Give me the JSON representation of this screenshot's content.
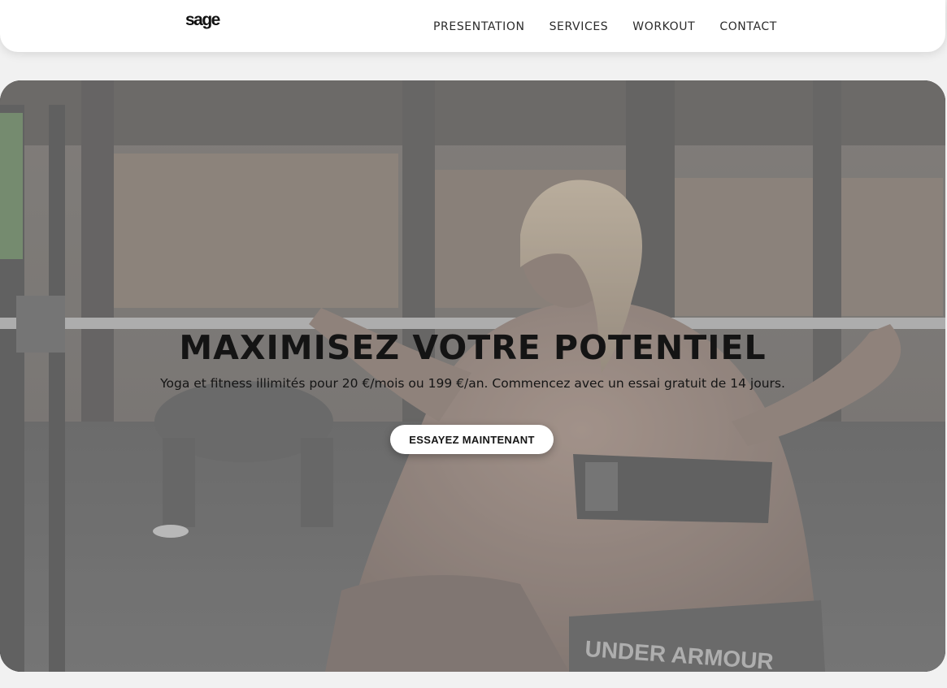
{
  "header": {
    "logo": "sage",
    "nav": [
      {
        "label": "PRESENTATION"
      },
      {
        "label": "SERVICES"
      },
      {
        "label": "WORKOUT"
      },
      {
        "label": "CONTACT"
      }
    ]
  },
  "hero": {
    "title": "MAXIMISEZ VOTRE POTENTIEL",
    "subtitle": "Yoga et fitness illimités pour 20 €/mois ou 199 €/an. Commencez avec un essai gratuit de 14 jours.",
    "cta_label": "ESSAYEZ MAINTENANT",
    "shorts_text": "UNDER ARMOUR"
  },
  "colors": {
    "page_bg": "#f1f1f1",
    "header_bg": "#ffffff",
    "text_dark": "#141414"
  }
}
